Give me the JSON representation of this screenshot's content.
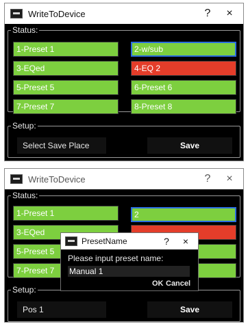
{
  "colors": {
    "preset_green": "#7dcf3f",
    "preset_red": "#e43d2a",
    "selection_blue": "#2a6de0",
    "background": "#000000"
  },
  "window1": {
    "title": "WriteToDevice",
    "help": "?",
    "close": "×",
    "status_label": "Status:",
    "presets": [
      "1-Preset 1",
      "2-w/sub",
      "3-EQed",
      "4-EQ 2",
      "5-Preset 5",
      "6-Preset 6",
      "7-Preset 7",
      "8-Preset 8"
    ],
    "setup_label": "Setup:",
    "save_place": "Select Save Place",
    "save_button": "Save"
  },
  "window2": {
    "title": "WriteToDevice",
    "help": "?",
    "close": "×",
    "status_label": "Status:",
    "presets_visible": [
      "1-Preset 1",
      "3-EQed",
      "5-Preset 5",
      "7-Preset 7"
    ],
    "right_partial": "2",
    "setup_label": "Setup:",
    "save_place": "Pos 1",
    "save_button": "Save"
  },
  "dialog": {
    "title": "PresetName",
    "help": "?",
    "close": "×",
    "prompt": "Please input preset name:",
    "input_value": "Manual 1",
    "ok": "OK",
    "cancel": "Cancel"
  }
}
